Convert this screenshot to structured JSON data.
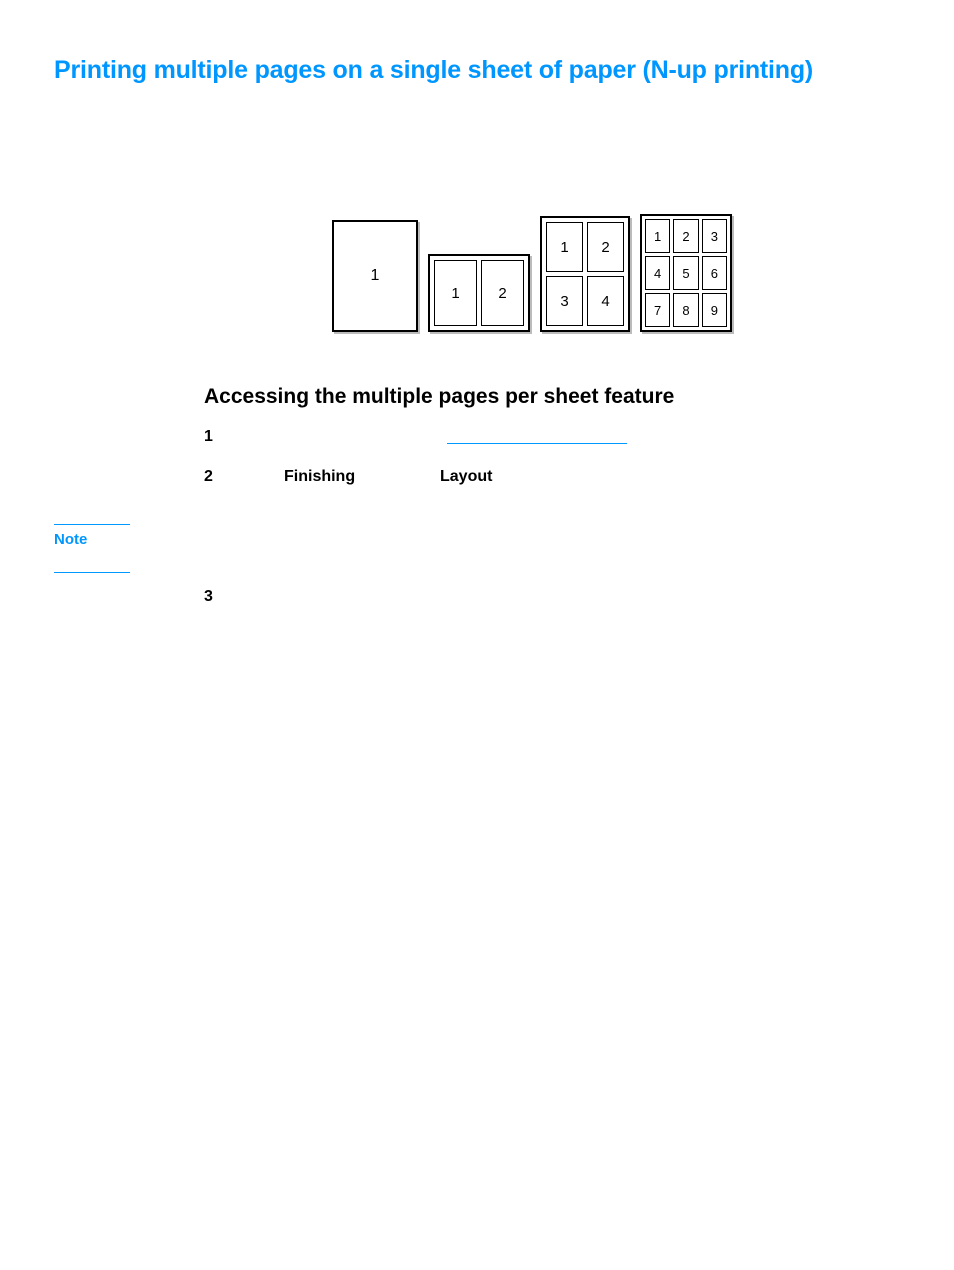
{
  "title": "Printing multiple pages on a single sheet of paper (N-up printing)",
  "subheading": "Accessing the multiple pages per sheet feature",
  "steps": {
    "s1": "1",
    "s2": "2",
    "s2_tab1": "Finishing",
    "s2_tab2": "Layout",
    "s3": "3"
  },
  "note_label": "Note",
  "illus": {
    "one": [
      "1"
    ],
    "two": [
      "1",
      "2"
    ],
    "four": [
      "1",
      "2",
      "3",
      "4"
    ],
    "nine": [
      "1",
      "2",
      "3",
      "4",
      "5",
      "6",
      "7",
      "8",
      "9"
    ]
  }
}
